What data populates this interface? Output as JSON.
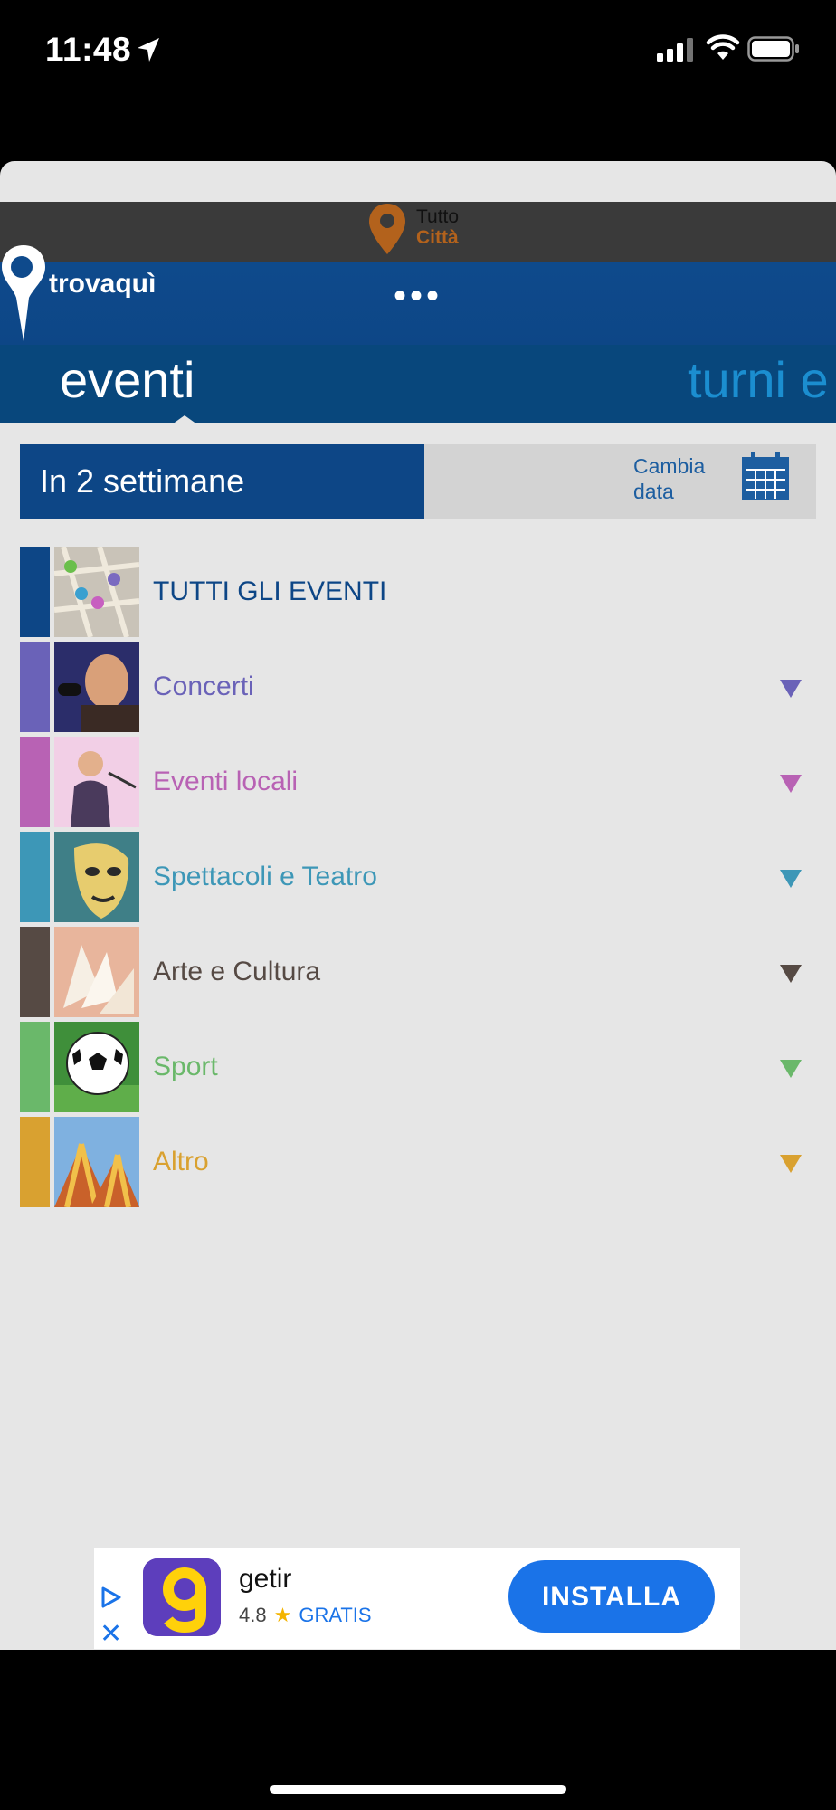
{
  "status": {
    "time": "11:48"
  },
  "topbar": {
    "line1": "Tutto",
    "line2": "Città"
  },
  "header": {
    "logo_text": "trovaquì",
    "menu_dots": "•••"
  },
  "tabs": {
    "active": "eventi",
    "next": "turni e"
  },
  "datebar": {
    "label": "In 2 settimane",
    "change_line1": "Cambia",
    "change_line2": "data"
  },
  "categories": [
    {
      "label": "TUTTI GLI EVENTI",
      "color": "#0d4686",
      "icon": "map-pins-icon"
    },
    {
      "label": "Concerti",
      "color": "#6a62b8",
      "icon": "singer-icon"
    },
    {
      "label": "Eventi locali",
      "color": "#b862b4",
      "icon": "speaker-icon"
    },
    {
      "label": "Spettacoli e Teatro",
      "color": "#3d97b7",
      "icon": "theater-mask-icon"
    },
    {
      "label": "Arte e Cultura",
      "color": "#564a44",
      "icon": "book-icon"
    },
    {
      "label": "Sport",
      "color": "#6ab86a",
      "icon": "soccer-ball-icon"
    },
    {
      "label": "Altro",
      "color": "#d9a130",
      "icon": "circus-tent-icon"
    }
  ],
  "ad": {
    "app_name": "getir",
    "rating": "4.8",
    "price": "GRATIS",
    "install": "INSTALLA",
    "close": "✕"
  }
}
